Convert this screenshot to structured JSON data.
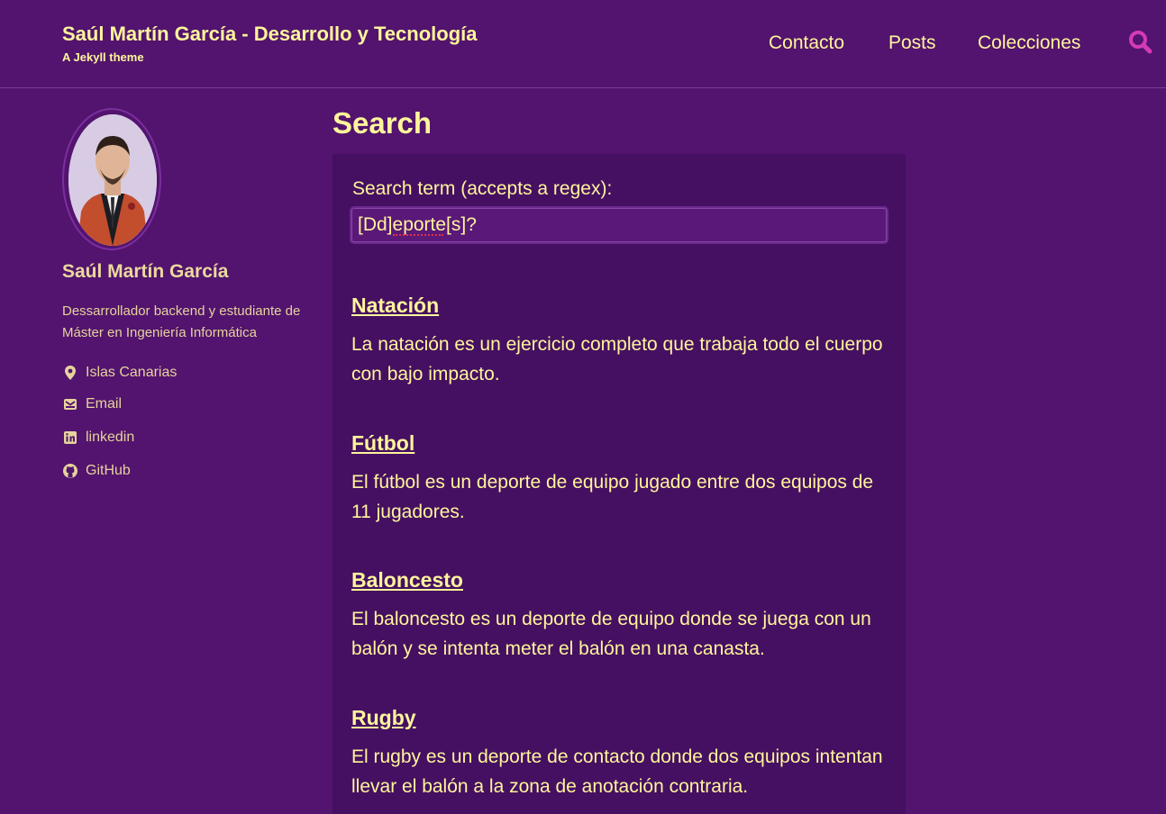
{
  "header": {
    "site_title": "Saúl Martín García - Desarrollo y Tecnología",
    "subtitle": "A Jekyll theme",
    "nav": [
      {
        "label": "Contacto"
      },
      {
        "label": "Posts"
      },
      {
        "label": "Colecciones"
      }
    ],
    "search_icon": "search-icon"
  },
  "author": {
    "name": "Saúl Martín García",
    "bio": "Dessarrollador backend y estudiante de Máster en Ingeniería Informática",
    "links": [
      {
        "icon": "location-icon",
        "label": "Islas Canarias"
      },
      {
        "icon": "envelope-icon",
        "label": "Email"
      },
      {
        "icon": "linkedin-icon",
        "label": "linkedin"
      },
      {
        "icon": "github-icon",
        "label": "GitHub"
      }
    ]
  },
  "main": {
    "title": "Search",
    "search_label": "Search term (accepts a regex):",
    "search_value": "[Dd]eporte[s]?",
    "results": [
      {
        "title": "Natación",
        "excerpt": "La natación es un ejercicio completo que trabaja todo el cuerpo con bajo impacto."
      },
      {
        "title": "Fútbol",
        "excerpt": "El fútbol es un deporte de equipo jugado entre dos equipos de 11 jugadores."
      },
      {
        "title": "Baloncesto",
        "excerpt": "El baloncesto es un deporte de equipo donde se juega con un balón y se intenta meter el balón en una canasta."
      },
      {
        "title": "Rugby",
        "excerpt": "El rugby es un deporte de contacto donde dos equipos intentan llevar el balón a la zona de anotación contraria."
      }
    ]
  },
  "colors": {
    "background": "#52146e",
    "panel": "#451062",
    "text": "#fff59b",
    "search_icon": "#d43ab8"
  }
}
